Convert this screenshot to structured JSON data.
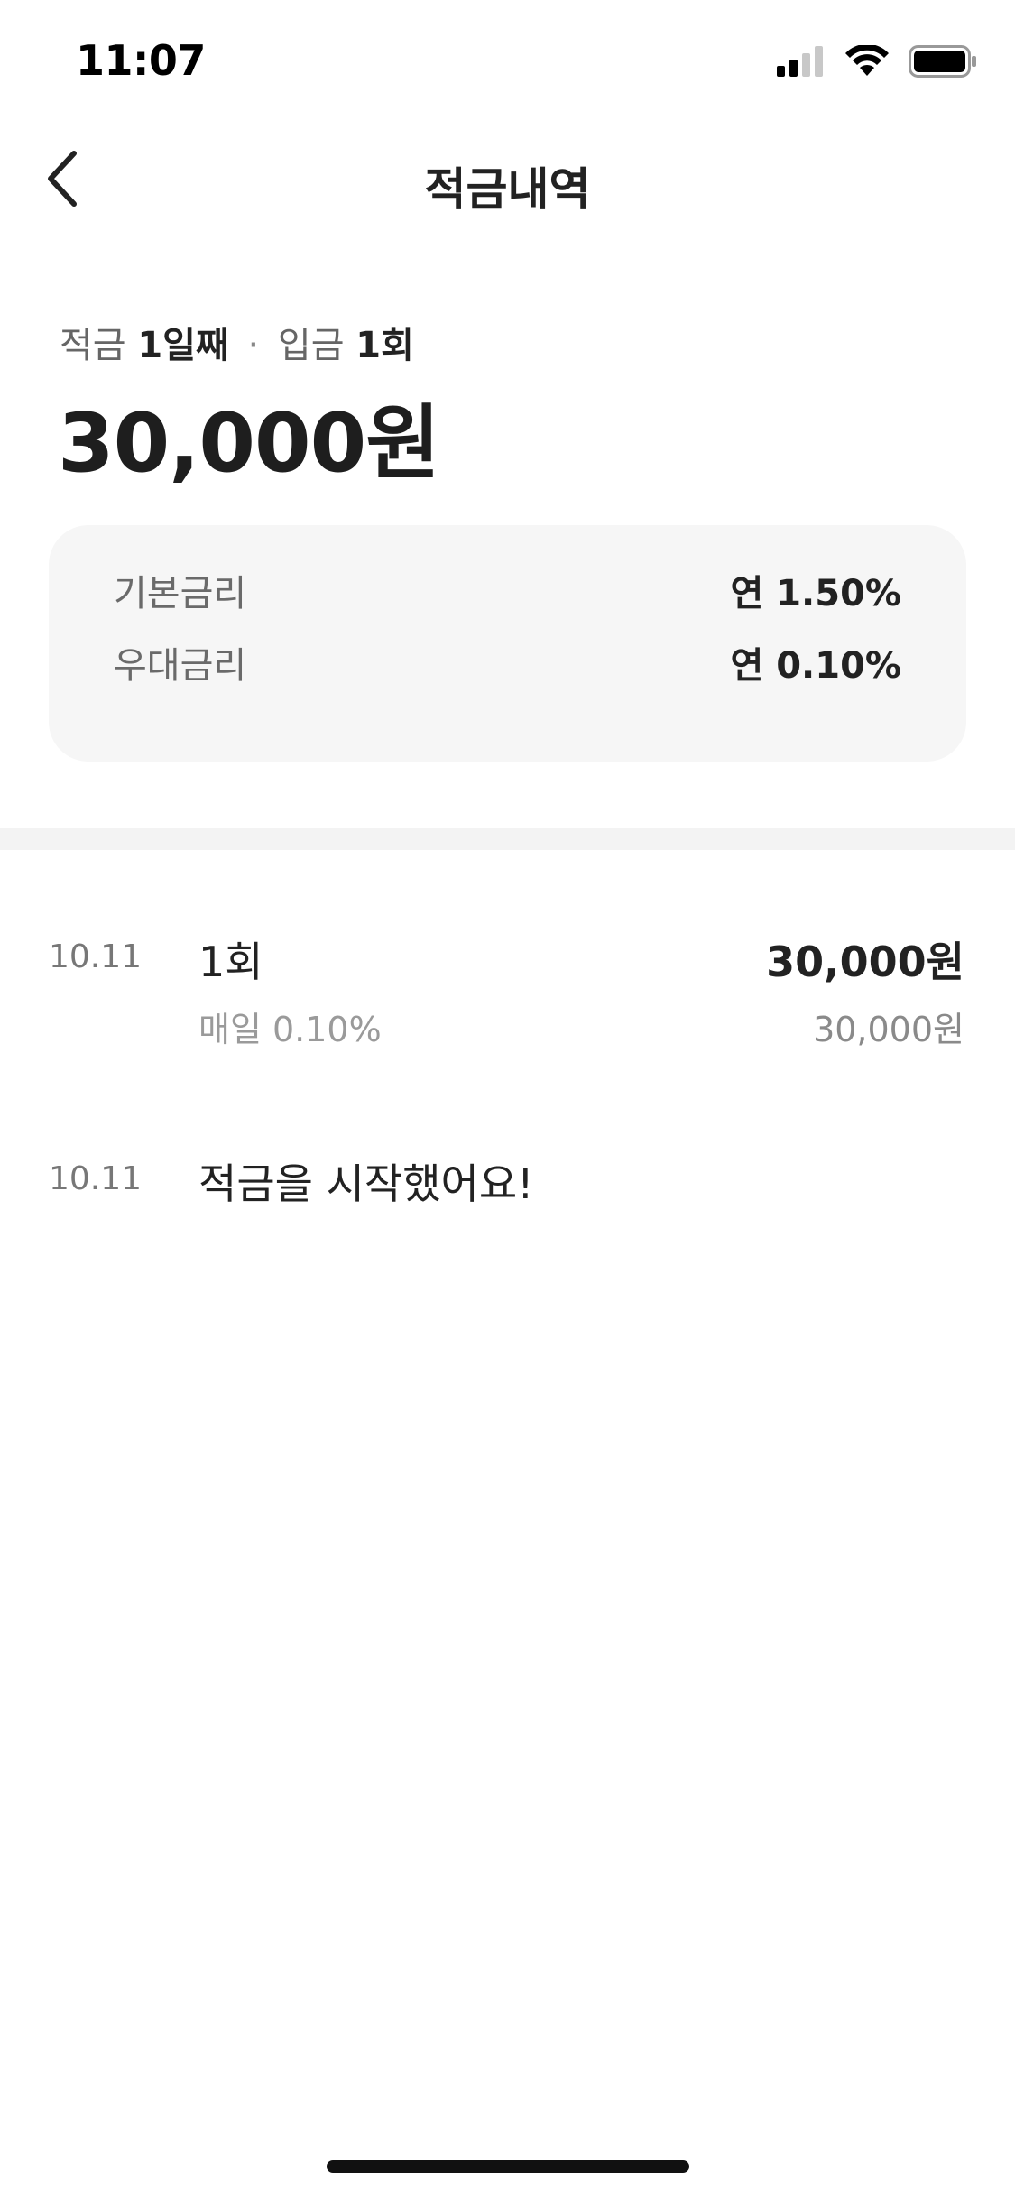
{
  "status_bar": {
    "time": "11:07",
    "icons": [
      "cellular-signal-icon",
      "wifi-icon",
      "battery-icon"
    ]
  },
  "nav": {
    "back_icon": "chevron-left-icon",
    "title": "적금내역"
  },
  "summary": {
    "saving_label": "적금",
    "day_count": "1일째",
    "separator": "·",
    "deposit_label": "입금",
    "deposit_count": "1회",
    "total_amount": "30,000원"
  },
  "rates": [
    {
      "label": "기본금리",
      "value": "연 1.50%"
    },
    {
      "label": "우대금리",
      "value": "연 0.10%"
    }
  ],
  "history": [
    {
      "date": "10.11",
      "title": "1회",
      "subtitle": "매일 0.10%",
      "amount": "30,000원",
      "balance": "30,000원"
    },
    {
      "date": "10.11",
      "title": "적금을 시작했어요!"
    }
  ],
  "colors": {
    "text_primary": "#222222",
    "text_secondary": "#6a6a6a",
    "text_tertiary": "#9a9a9a",
    "card_background": "#f6f6f6",
    "divider": "#f3f3f3"
  }
}
